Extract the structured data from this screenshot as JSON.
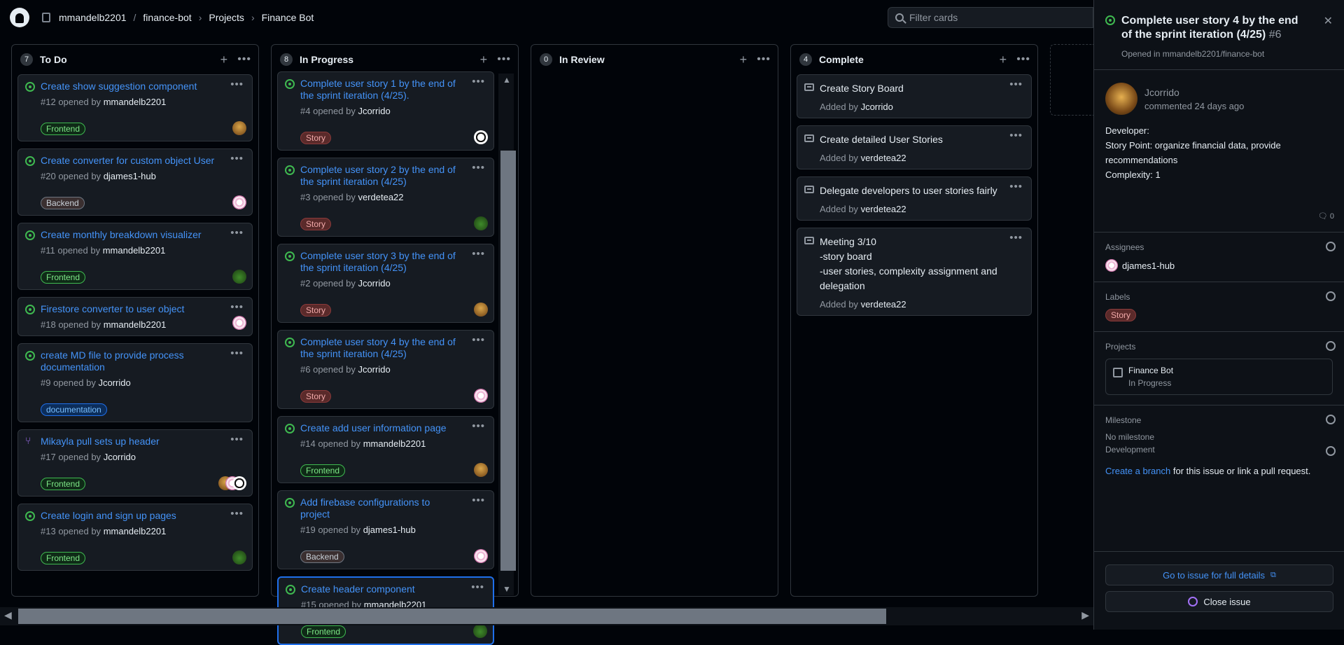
{
  "breadcrumb": {
    "owner": "mmandelb2201",
    "repo": "finance-bot",
    "projects": "Projects",
    "project": "Finance Bot"
  },
  "filter": {
    "placeholder": "Filter cards"
  },
  "columns": [
    {
      "title": "To Do",
      "count": "7",
      "cards": [
        {
          "title": "Create show suggestion component",
          "num": "#12",
          "by": "mmandelb2201",
          "label": "Frontend",
          "avatar": "tan"
        },
        {
          "title": "Create converter for custom object User",
          "num": "#20",
          "by": "djames1-hub",
          "label": "Backend",
          "avatar": "pink"
        },
        {
          "title": "Create monthly breakdown visualizer",
          "num": "#11",
          "by": "mmandelb2201",
          "label": "Frontend",
          "avatar": "green"
        },
        {
          "title": "Firestore converter to user object",
          "num": "#18",
          "by": "mmandelb2201",
          "label": "",
          "avatar": "pink"
        },
        {
          "title": "create MD file to provide process documentation",
          "num": "#9",
          "by": "Jcorrido",
          "label": "documentation",
          "avatar": ""
        },
        {
          "title": "Mikayla pull sets up header",
          "num": "#17",
          "by": "Jcorrido",
          "label": "Frontend",
          "avatar": "multi",
          "pr": true
        },
        {
          "title": "Create login and sign up pages",
          "num": "#13",
          "by": "mmandelb2201",
          "label": "Frontend",
          "avatar": "green"
        }
      ]
    },
    {
      "title": "In Progress",
      "count": "8",
      "cards": [
        {
          "title": "Complete user story 1 by the end of the sprint iteration (4/25).",
          "num": "#4",
          "by": "Jcorrido",
          "label": "Story",
          "avatar": "bw"
        },
        {
          "title": "Complete user story 2 by the end of the sprint iteration (4/25)",
          "num": "#3",
          "by": "verdetea22",
          "label": "Story",
          "avatar": "green"
        },
        {
          "title": "Complete user story 3 by the end of the sprint iteration (4/25)",
          "num": "#2",
          "by": "Jcorrido",
          "label": "Story",
          "avatar": "tan"
        },
        {
          "title": "Complete user story 4 by the end of the sprint iteration (4/25)",
          "num": "#6",
          "by": "Jcorrido",
          "label": "Story",
          "avatar": "pink"
        },
        {
          "title": "Create add user information page",
          "num": "#14",
          "by": "mmandelb2201",
          "label": "Frontend",
          "avatar": "tan"
        },
        {
          "title": "Add firebase configurations to project",
          "num": "#19",
          "by": "djames1-hub",
          "label": "Backend",
          "avatar": "pink"
        },
        {
          "title": "Create header component",
          "num": "#15",
          "by": "mmandelb2201",
          "label": "Frontend",
          "avatar": "green",
          "selected": true
        }
      ]
    },
    {
      "title": "In Review",
      "count": "0",
      "cards": []
    },
    {
      "title": "Complete",
      "count": "4",
      "notes": [
        {
          "text": "Create Story Board",
          "by": "Jcorrido"
        },
        {
          "text": "Create detailed User Stories",
          "by": "verdetea22"
        },
        {
          "text": "Delegate developers to user stories fairly",
          "by": "verdetea22"
        },
        {
          "text": "Meeting 3/10\n-story board\n-user stories, complexity assignment and delegation",
          "by": "verdetea22"
        }
      ]
    }
  ],
  "strings": {
    "opened_by": "opened by",
    "added_by": "Added by"
  },
  "panel": {
    "title": "Complete user story 4 by the end of the sprint iteration (4/25)",
    "number": "#6",
    "opened_in_prefix": "Opened in",
    "opened_in_repo": "mmandelb2201/finance-bot",
    "commenter": "Jcorrido",
    "commented": "commented 24 days ago",
    "body": "Developer:\nStory Point: organize financial data, provide recommendations\nComplexity: 1",
    "comment_count": "0",
    "assignees_title": "Assignees",
    "assignee": "djames1-hub",
    "labels_title": "Labels",
    "label": "Story",
    "projects_title": "Projects",
    "project_name": "Finance Bot",
    "project_status": "In Progress",
    "milestone_title": "Milestone",
    "milestone_value": "No milestone",
    "development_title": "Development",
    "dev_link": "Create a branch",
    "dev_rest": " for this issue or link a pull request.",
    "go_to_issue": "Go to issue for full details",
    "close_issue": "Close issue"
  }
}
